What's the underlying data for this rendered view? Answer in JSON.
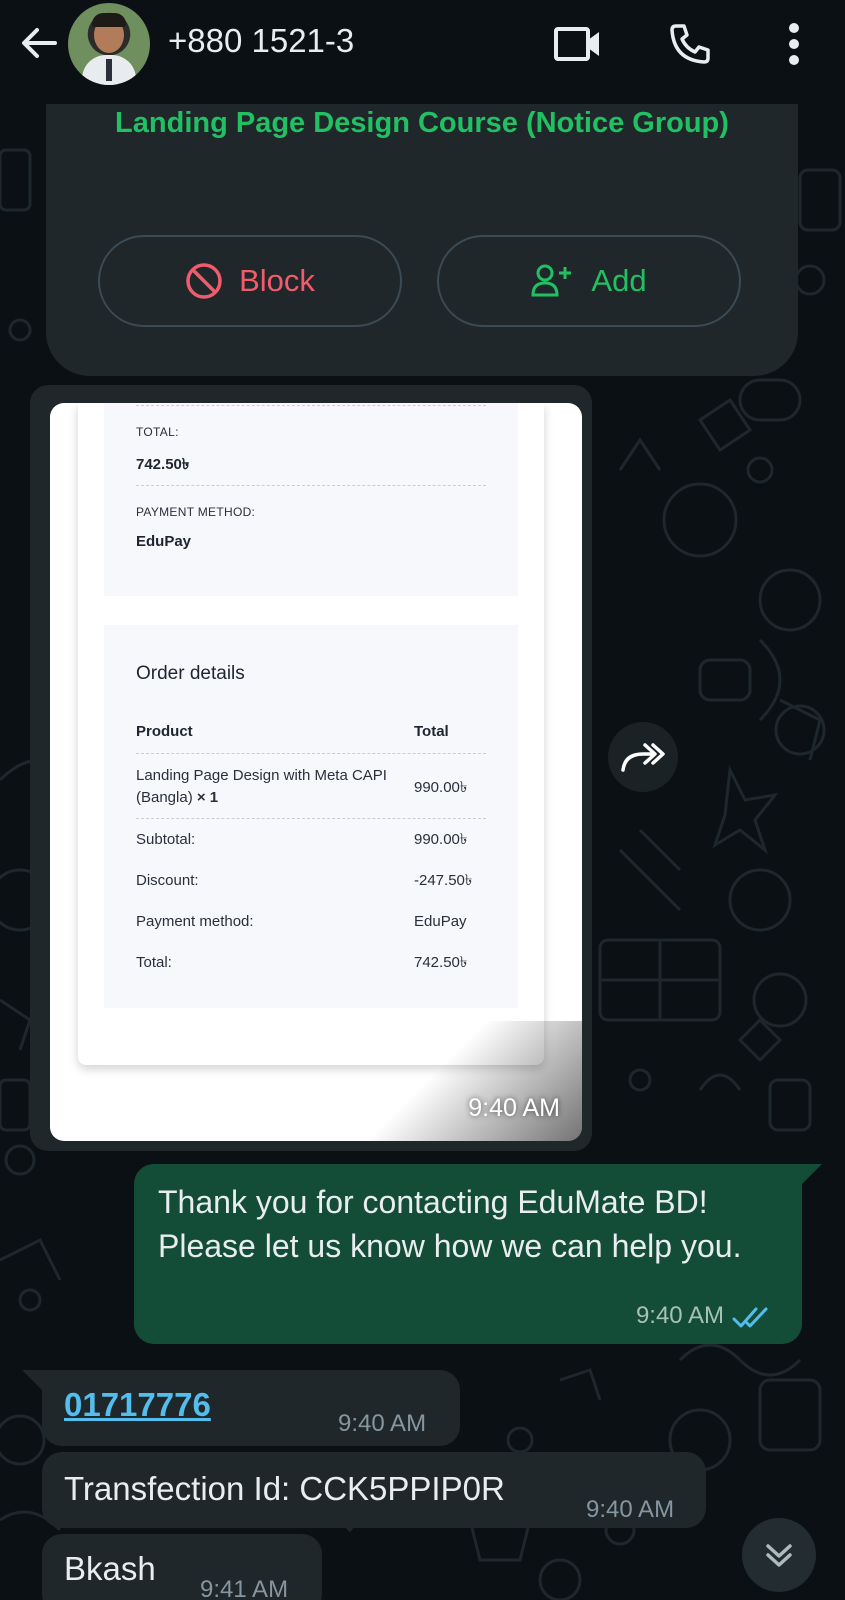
{
  "header": {
    "back_icon": "arrow-left-icon",
    "contact_name": "+880 1521-3",
    "video_icon": "video-call-icon",
    "call_icon": "phone-icon",
    "menu_icon": "more-vertical-icon"
  },
  "contact_card": {
    "group_title": "Landing Page Design Course (Notice Group)",
    "block_label": "Block",
    "add_label": "Add",
    "block_color": "#f15c6d",
    "add_color": "#21c063"
  },
  "image_message": {
    "time": "9:40 AM",
    "receipt": {
      "total_label": "TOTAL:",
      "total_value": "742.50৳",
      "payment_method_label": "PAYMENT METHOD:",
      "payment_method_value": "EduPay",
      "order_details_title": "Order details",
      "col_product": "Product",
      "col_total": "Total",
      "product_name": "Landing Page Design with Meta CAPI (Bangla)",
      "product_qty": "× 1",
      "product_price": "990.00৳",
      "rows": [
        {
          "label": "Subtotal:",
          "value": "990.00৳"
        },
        {
          "label": "Discount:",
          "value": "-247.50৳"
        },
        {
          "label": "Payment method:",
          "value": "EduPay"
        },
        {
          "label": "Total:",
          "value": "742.50৳"
        }
      ]
    }
  },
  "outgoing_message": {
    "text": "Thank you for contacting EduMate BD! Please let us know how we can help you.",
    "time": "9:40 AM",
    "status": "read",
    "tick_color": "#53bdeb"
  },
  "incoming_messages": [
    {
      "text": "01717776",
      "time": "9:40 AM",
      "is_link": true
    },
    {
      "text": "Transfection Id: CCK5PPIP0R",
      "time": "9:40 AM",
      "is_link": false
    },
    {
      "text": "Bkash",
      "time": "9:41 AM",
      "is_link": false
    }
  ],
  "forward_icon": "forward-icon",
  "scroll_down_icon": "chevron-double-down-icon"
}
